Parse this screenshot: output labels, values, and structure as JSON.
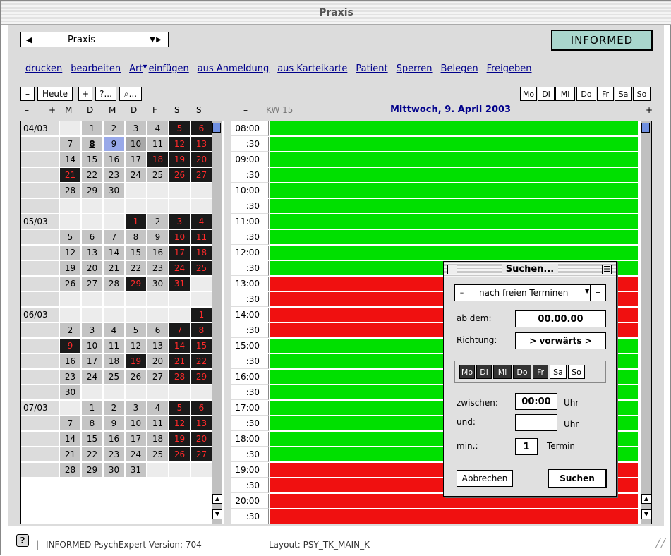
{
  "window": {
    "title": "Praxis"
  },
  "popup": {
    "left_arrow": "◀",
    "label": "Praxis",
    "right_arrows": "▼ ▶"
  },
  "logo": "INFORMED",
  "menu": [
    {
      "label": "drucken"
    },
    {
      "label": "bearbeiten"
    },
    {
      "label": "Art",
      "arrow": "▼"
    },
    {
      "label": "einfügen"
    },
    {
      "label": "aus Anmeldung"
    },
    {
      "label": "aus Karteikarte"
    },
    {
      "label": "Patient"
    },
    {
      "label": "Sperren"
    },
    {
      "label": "Belegen"
    },
    {
      "label": "Freigeben"
    }
  ],
  "toolbar": {
    "minus": "–",
    "heute": "Heute",
    "plus": "+",
    "query": "?...",
    "search": "⌕..."
  },
  "weekday_buttons": [
    "Mo",
    "Di",
    "Mi",
    "Do",
    "Fr",
    "Sa",
    "So"
  ],
  "calendar": {
    "nav_minus": "–",
    "nav_plus": "+",
    "day_headers": [
      "M",
      "D",
      "M",
      "D",
      "F",
      "S",
      "S"
    ],
    "months": [
      {
        "label": "04/03",
        "rows": [
          [
            [
              "",
              ""
            ],
            [
              "1",
              "g"
            ],
            [
              "2",
              "g"
            ],
            [
              "3",
              "g"
            ],
            [
              "4",
              "g"
            ],
            [
              "5",
              "k"
            ],
            [
              "6",
              "k"
            ]
          ],
          [
            [
              "7",
              "g"
            ],
            [
              "8",
              "u"
            ],
            [
              "9",
              "s"
            ],
            [
              "10",
              "g2"
            ],
            [
              "11",
              "g"
            ],
            [
              "12",
              "k"
            ],
            [
              "13",
              "k"
            ]
          ],
          [
            [
              "14",
              "g"
            ],
            [
              "15",
              "g"
            ],
            [
              "16",
              "g"
            ],
            [
              "17",
              "g"
            ],
            [
              "18",
              "k"
            ],
            [
              "19",
              "k"
            ],
            [
              "20",
              "k"
            ]
          ],
          [
            [
              "21",
              "k"
            ],
            [
              "22",
              "g"
            ],
            [
              "23",
              "g"
            ],
            [
              "24",
              "g"
            ],
            [
              "25",
              "g"
            ],
            [
              "26",
              "k"
            ],
            [
              "27",
              "k"
            ]
          ],
          [
            [
              "28",
              "g"
            ],
            [
              "29",
              "g"
            ],
            [
              "30",
              "g"
            ],
            [
              "",
              "w"
            ],
            [
              "",
              "w"
            ],
            [
              "",
              "w"
            ],
            [
              "",
              "w"
            ]
          ],
          [
            [
              "",
              "w"
            ],
            [
              "",
              "w"
            ],
            [
              "",
              "w"
            ],
            [
              "",
              "w"
            ],
            [
              "",
              "w"
            ],
            [
              "",
              "w"
            ],
            [
              "",
              "w"
            ]
          ]
        ]
      },
      {
        "label": "05/03",
        "rows": [
          [
            [
              "",
              "w"
            ],
            [
              "",
              "w"
            ],
            [
              "",
              "w"
            ],
            [
              "1",
              "k"
            ],
            [
              "2",
              "g"
            ],
            [
              "3",
              "k"
            ],
            [
              "4",
              "k"
            ]
          ],
          [
            [
              "5",
              "g"
            ],
            [
              "6",
              "g"
            ],
            [
              "7",
              "g"
            ],
            [
              "8",
              "g"
            ],
            [
              "9",
              "g"
            ],
            [
              "10",
              "k"
            ],
            [
              "11",
              "k"
            ]
          ],
          [
            [
              "12",
              "g"
            ],
            [
              "13",
              "g"
            ],
            [
              "14",
              "g"
            ],
            [
              "15",
              "g"
            ],
            [
              "16",
              "g"
            ],
            [
              "17",
              "k"
            ],
            [
              "18",
              "k"
            ]
          ],
          [
            [
              "19",
              "g"
            ],
            [
              "20",
              "g"
            ],
            [
              "21",
              "g"
            ],
            [
              "22",
              "g"
            ],
            [
              "23",
              "g"
            ],
            [
              "24",
              "k"
            ],
            [
              "25",
              "k"
            ]
          ],
          [
            [
              "26",
              "g"
            ],
            [
              "27",
              "g"
            ],
            [
              "28",
              "g"
            ],
            [
              "29",
              "k"
            ],
            [
              "30",
              "g"
            ],
            [
              "31",
              "k"
            ],
            [
              "",
              "w"
            ]
          ],
          [
            [
              "",
              "w"
            ],
            [
              "",
              "w"
            ],
            [
              "",
              "w"
            ],
            [
              "",
              "w"
            ],
            [
              "",
              "w"
            ],
            [
              "",
              "w"
            ],
            [
              "",
              "w"
            ]
          ]
        ]
      },
      {
        "label": "06/03",
        "rows": [
          [
            [
              "",
              "w"
            ],
            [
              "",
              "w"
            ],
            [
              "",
              "w"
            ],
            [
              "",
              "w"
            ],
            [
              "",
              "w"
            ],
            [
              "",
              "w"
            ],
            [
              "1",
              "k"
            ]
          ],
          [
            [
              "2",
              "g"
            ],
            [
              "3",
              "g"
            ],
            [
              "4",
              "g"
            ],
            [
              "5",
              "g"
            ],
            [
              "6",
              "g"
            ],
            [
              "7",
              "k"
            ],
            [
              "8",
              "k"
            ]
          ],
          [
            [
              "9",
              "k"
            ],
            [
              "10",
              "g"
            ],
            [
              "11",
              "g"
            ],
            [
              "12",
              "g"
            ],
            [
              "13",
              "g"
            ],
            [
              "14",
              "k"
            ],
            [
              "15",
              "k"
            ]
          ],
          [
            [
              "16",
              "g"
            ],
            [
              "17",
              "g"
            ],
            [
              "18",
              "g"
            ],
            [
              "19",
              "k"
            ],
            [
              "20",
              "g"
            ],
            [
              "21",
              "k"
            ],
            [
              "22",
              "k"
            ]
          ],
          [
            [
              "23",
              "g"
            ],
            [
              "24",
              "g"
            ],
            [
              "25",
              "g"
            ],
            [
              "26",
              "g"
            ],
            [
              "27",
              "g"
            ],
            [
              "28",
              "k"
            ],
            [
              "29",
              "k"
            ]
          ],
          [
            [
              "30",
              "g"
            ],
            [
              "",
              "w"
            ],
            [
              "",
              "w"
            ],
            [
              "",
              "w"
            ],
            [
              "",
              "w"
            ],
            [
              "",
              "w"
            ],
            [
              "",
              "w"
            ]
          ]
        ]
      },
      {
        "label": "07/03",
        "rows": [
          [
            [
              "",
              "w"
            ],
            [
              "1",
              "g"
            ],
            [
              "2",
              "g"
            ],
            [
              "3",
              "g"
            ],
            [
              "4",
              "g"
            ],
            [
              "5",
              "k"
            ],
            [
              "6",
              "k"
            ]
          ],
          [
            [
              "7",
              "g"
            ],
            [
              "8",
              "g"
            ],
            [
              "9",
              "g"
            ],
            [
              "10",
              "g"
            ],
            [
              "11",
              "g"
            ],
            [
              "12",
              "k"
            ],
            [
              "13",
              "k"
            ]
          ],
          [
            [
              "14",
              "g"
            ],
            [
              "15",
              "g"
            ],
            [
              "16",
              "g"
            ],
            [
              "17",
              "g"
            ],
            [
              "18",
              "g"
            ],
            [
              "19",
              "k"
            ],
            [
              "20",
              "k"
            ]
          ],
          [
            [
              "21",
              "g"
            ],
            [
              "22",
              "g"
            ],
            [
              "23",
              "g"
            ],
            [
              "24",
              "g"
            ],
            [
              "25",
              "g"
            ],
            [
              "26",
              "k"
            ],
            [
              "27",
              "k"
            ]
          ],
          [
            [
              "28",
              "g"
            ],
            [
              "29",
              "g"
            ],
            [
              "30",
              "g"
            ],
            [
              "31",
              "g"
            ],
            [
              "",
              "w"
            ],
            [
              "",
              "w"
            ],
            [
              "",
              "w"
            ]
          ]
        ]
      }
    ]
  },
  "day_view": {
    "minus": "–",
    "kw": "KW 15",
    "date": "Mittwoch, 9. April 2003",
    "plus": "+",
    "slots": [
      {
        "time": "08:00",
        "state": "free"
      },
      {
        "time": ":30",
        "state": "free"
      },
      {
        "time": "09:00",
        "state": "free"
      },
      {
        "time": ":30",
        "state": "free"
      },
      {
        "time": "10:00",
        "state": "free"
      },
      {
        "time": ":30",
        "state": "free"
      },
      {
        "time": "11:00",
        "state": "free"
      },
      {
        "time": ":30",
        "state": "free"
      },
      {
        "time": "12:00",
        "state": "free"
      },
      {
        "time": ":30",
        "state": "free"
      },
      {
        "time": "13:00",
        "state": "busy"
      },
      {
        "time": ":30",
        "state": "busy"
      },
      {
        "time": "14:00",
        "state": "busy"
      },
      {
        "time": ":30",
        "state": "busy"
      },
      {
        "time": "15:00",
        "state": "free"
      },
      {
        "time": ":30",
        "state": "free"
      },
      {
        "time": "16:00",
        "state": "free"
      },
      {
        "time": ":30",
        "state": "free"
      },
      {
        "time": "17:00",
        "state": "free"
      },
      {
        "time": ":30",
        "state": "free"
      },
      {
        "time": "18:00",
        "state": "free"
      },
      {
        "time": ":30",
        "state": "free"
      },
      {
        "time": "19:00",
        "state": "busy"
      },
      {
        "time": ":30",
        "state": "busy"
      },
      {
        "time": "20:00",
        "state": "busy"
      },
      {
        "time": ":30",
        "state": "busy"
      }
    ]
  },
  "dialog": {
    "title": "Suchen...",
    "minus": "–",
    "mode": "nach freien Terminen",
    "plus": "+",
    "ab_dem_label": "ab dem:",
    "ab_dem_value": "00.00.00",
    "richtung_label": "Richtung:",
    "richtung_value": "> vorwärts >",
    "weekdays": [
      {
        "label": "Mo",
        "on": true
      },
      {
        "label": "Di",
        "on": true
      },
      {
        "label": "Mi",
        "on": true
      },
      {
        "label": "Do",
        "on": true
      },
      {
        "label": "Fr",
        "on": true
      },
      {
        "label": "Sa",
        "on": false
      },
      {
        "label": "So",
        "on": false
      }
    ],
    "zwischen_label": "zwischen:",
    "zwischen_value": "00:00",
    "uhr1": "Uhr",
    "und_label": "und:",
    "und_value": "",
    "uhr2": "Uhr",
    "min_label": "min.:",
    "min_value": "1",
    "termin": "Termin",
    "cancel": "Abbrechen",
    "search": "Suchen"
  },
  "status": {
    "help": "?",
    "version": "INFORMED PsychExpert Version: 704",
    "layout": "Layout: PSY_TK_MAIN_K"
  },
  "colors": {
    "free": "#00e000",
    "busy": "#f01010",
    "accent": "#00008b"
  }
}
